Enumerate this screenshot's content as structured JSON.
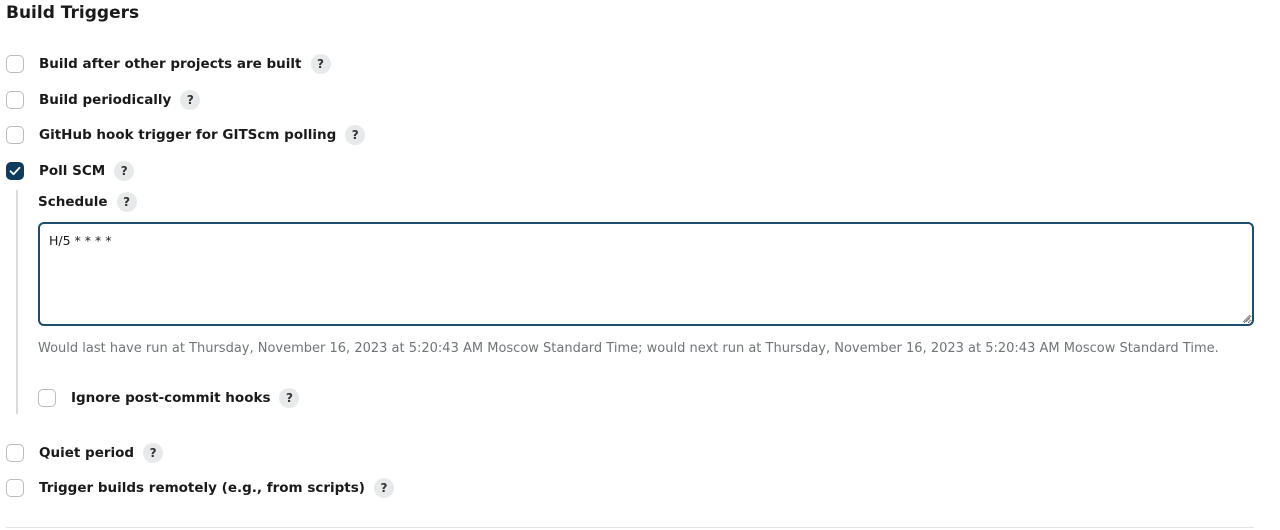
{
  "section": {
    "title": "Build Triggers"
  },
  "triggers": [
    {
      "label": "Build after other projects are built",
      "checked": false,
      "help": "?"
    },
    {
      "label": "Build periodically",
      "checked": false,
      "help": "?"
    },
    {
      "label": "GitHub hook trigger for GITScm polling",
      "checked": false,
      "help": "?"
    },
    {
      "label": "Poll SCM",
      "checked": true,
      "help": "?"
    }
  ],
  "poll_scm": {
    "schedule_label": "Schedule",
    "schedule_help": "?",
    "schedule_value": "H/5 * * * *",
    "hint": "Would last have run at Thursday, November 16, 2023 at 5:20:43 AM Moscow Standard Time; would next run at Thursday, November 16, 2023 at 5:20:43 AM Moscow Standard Time.",
    "ignore_hooks": {
      "label": "Ignore post-commit hooks",
      "checked": false,
      "help": "?"
    }
  },
  "more_triggers": [
    {
      "label": "Quiet period",
      "checked": false,
      "help": "?"
    },
    {
      "label": "Trigger builds remotely (e.g., from scripts)",
      "checked": false,
      "help": "?"
    }
  ],
  "colors": {
    "checked_fill": "#0f3b5c",
    "textarea_border": "#1f4d6b",
    "hint_text": "#6f7478"
  }
}
